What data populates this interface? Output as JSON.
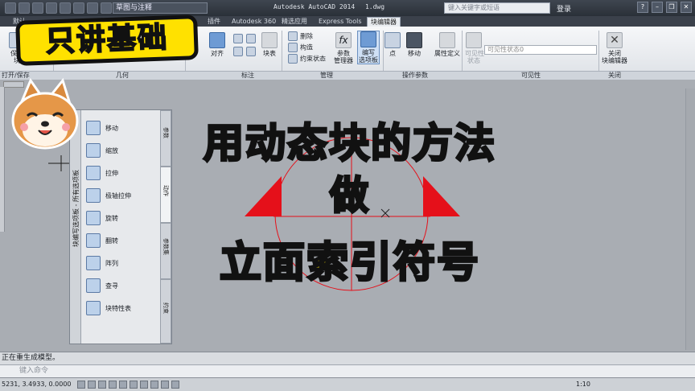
{
  "titlebar": {
    "workspace": "草图与注释",
    "app_name": "Autodesk AutoCAD 2014",
    "file_name": "1.dwg",
    "search_placeholder": "键入关键字或短语",
    "login": "登录"
  },
  "tabs": [
    {
      "label": "默认"
    },
    {
      "label": "插件"
    },
    {
      "label": "Autodesk 360"
    },
    {
      "label": "精选应用"
    },
    {
      "label": "Express Tools"
    },
    {
      "label": "块编辑器",
      "active": true
    }
  ],
  "ribbon": {
    "buttons": {
      "open_save": "保存\n块",
      "align": "对齐",
      "block_table": "块表",
      "delete": "删除",
      "construct": "构造",
      "constraint_state": "约束状态",
      "param_manager": "参数\n管理器",
      "authoring_palettes": "编写\n选项板",
      "point": "点",
      "move": "移动",
      "attribute_def": "属性定义",
      "visibility_state": "可见性\n状态",
      "close_editor": "关闭\n块编辑器"
    },
    "visibility_select": "可见性状态0",
    "groups": {
      "open_save": "打开/保存",
      "geometry": "几何",
      "dimension": "标注",
      "manage": "管理",
      "action_params": "操作参数",
      "visibility": "可见性",
      "close": "关闭"
    }
  },
  "palette": {
    "title": "块编写选项板 - 所有选项板",
    "items": [
      {
        "label": "移动",
        "icon": "move-action-icon"
      },
      {
        "label": "缩放",
        "icon": "scale-action-icon"
      },
      {
        "label": "拉伸",
        "icon": "stretch-action-icon"
      },
      {
        "label": "极轴拉伸",
        "icon": "polar-stretch-action-icon"
      },
      {
        "label": "旋转",
        "icon": "rotate-action-icon"
      },
      {
        "label": "翻转",
        "icon": "flip-action-icon"
      },
      {
        "label": "阵列",
        "icon": "array-action-icon"
      },
      {
        "label": "查寻",
        "icon": "lookup-action-icon"
      },
      {
        "label": "块特性表",
        "icon": "block-table-action-icon"
      }
    ],
    "tabs": [
      {
        "label": "参数"
      },
      {
        "label": "动作",
        "active": true
      },
      {
        "label": "参数集"
      },
      {
        "label": "约束"
      }
    ]
  },
  "command": {
    "history": "正在重生成模型。",
    "input_placeholder": "键入命令"
  },
  "status": {
    "coordinates": "5231, 3.4933, 0.0000",
    "scale": "1:10"
  },
  "overlay": {
    "badge": "只讲基础",
    "line1": "用动态块的方法",
    "line2": "做",
    "line3": "立面索引符号"
  },
  "colors": {
    "drawing_bg": "#a9adb3",
    "symbol_red": "#e5101a",
    "overlay_yellow": "#ffe400",
    "badge_yellow": "#ffe100"
  }
}
